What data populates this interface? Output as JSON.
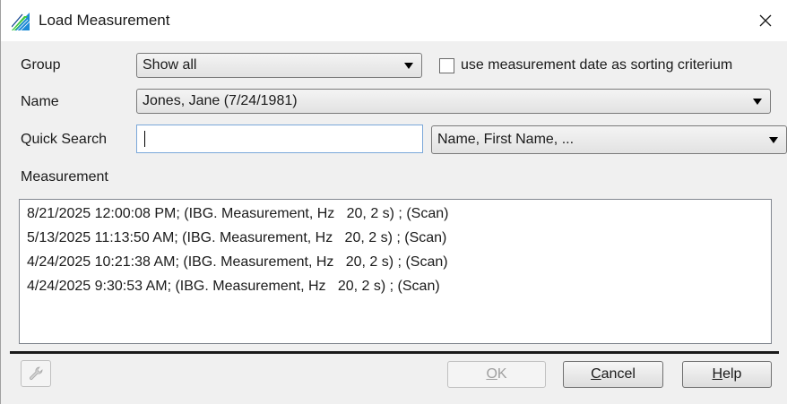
{
  "window": {
    "title": "Load Measurement",
    "icon": "app-logo-icon",
    "close_glyph": "✕"
  },
  "group": {
    "label": "Group",
    "selected": "Show all",
    "checkbox_label": "use measurement date as sorting criterium",
    "checkbox_checked": false
  },
  "name": {
    "label": "Name",
    "selected": "Jones, Jane (7/24/1981)"
  },
  "quick_search": {
    "label": "Quick Search",
    "value": "",
    "field_selected": "Name, First Name, ..."
  },
  "measurement": {
    "label": "Measurement",
    "items": [
      "8/21/2025 12:00:08 PM; (IBG. Measurement, Hz   20, 2 s) ; (Scan)",
      "5/13/2025 11:13:50 AM; (IBG. Measurement, Hz   20, 2 s) ; (Scan)",
      "4/24/2025 10:21:38 AM; (IBG. Measurement, Hz   20, 2 s) ; (Scan)",
      "4/24/2025 9:30:53 AM; (IBG. Measurement, Hz   20, 2 s) ; (Scan)"
    ]
  },
  "buttons": {
    "ok_mnemonic": "O",
    "ok_rest": "K",
    "ok_enabled": false,
    "cancel_mnemonic": "C",
    "cancel_rest": "ancel",
    "help_mnemonic": "H",
    "help_rest": "elp",
    "tool_icon": "wrench-icon"
  }
}
